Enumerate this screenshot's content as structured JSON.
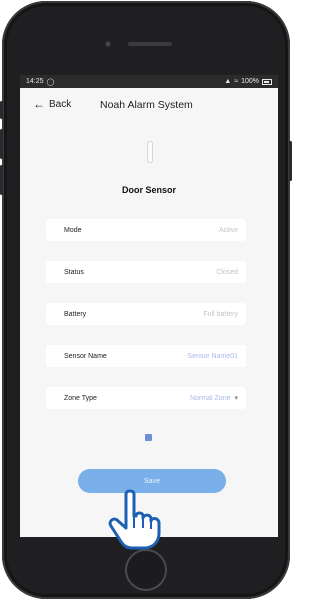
{
  "status_bar": {
    "time": "14:25",
    "right": "100%"
  },
  "nav": {
    "back_label": "Back",
    "title": "Noah Alarm System"
  },
  "device": {
    "title": "Door Sensor"
  },
  "rows": [
    {
      "label": "Mode",
      "value": "Active"
    },
    {
      "label": "Status",
      "value": "Closed"
    },
    {
      "label": "Battery",
      "value": "Full battery"
    },
    {
      "label": "Sensor Name",
      "value": "Sensor Name01"
    },
    {
      "label": "Zone Type",
      "value": "Normal Zone"
    }
  ],
  "save": {
    "label": "Save"
  },
  "colors": {
    "accent": "#7ab0ea",
    "link": "#a9b9e8",
    "phone_body": "#1f1f21",
    "screen_bg": "#f6f6f6"
  },
  "icons": [
    "back-arrow-icon",
    "sensor-device-icon",
    "chevron-down-icon",
    "hand-pointer-icon",
    "battery-icon",
    "wifi-icon",
    "signal-icon"
  ]
}
